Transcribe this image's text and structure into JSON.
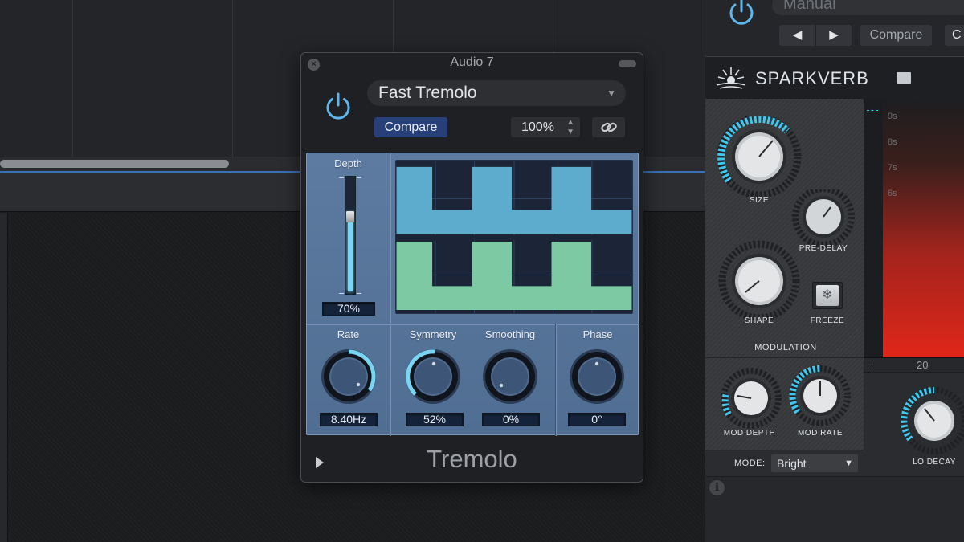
{
  "tremolo": {
    "window_title": "Audio 7",
    "preset": "Fast Tremolo",
    "compare_label": "Compare",
    "zoom": "100%",
    "plugin_name": "Tremolo",
    "depth": {
      "label": "Depth",
      "value": "70%",
      "level": 0.7
    },
    "rate": {
      "label": "Rate",
      "value": "8.40Hz"
    },
    "symmetry": {
      "label": "Symmetry",
      "value": "52%"
    },
    "smoothing": {
      "label": "Smoothing",
      "value": "0%"
    },
    "phase": {
      "label": "Phase",
      "value": "0°"
    },
    "colors": {
      "accent": "#79d6f3",
      "wave_top": "#5eaccd",
      "wave_bottom": "#7dc9a4",
      "panel": "#5d7ba0"
    }
  },
  "sparkverb": {
    "preset": "Manual",
    "compare_label": "Compare",
    "c_label": "C",
    "title": "SPARKVERB",
    "knobs": {
      "size": "SIZE",
      "pre_delay": "PRE-DELAY",
      "shape": "SHAPE",
      "freeze": "FREEZE",
      "mod_depth": "MOD DEPTH",
      "mod_rate": "MOD RATE",
      "lo_decay": "LO DECAY"
    },
    "modulation_label": "MODULATION",
    "mode_label": "MODE:",
    "mode_value": "Bright",
    "display_scale": [
      "9s",
      "8s",
      "7s",
      "6s"
    ],
    "display_freq": "20",
    "colors": {
      "accent": "#3ec8ef",
      "decay": "#e0261a"
    }
  }
}
